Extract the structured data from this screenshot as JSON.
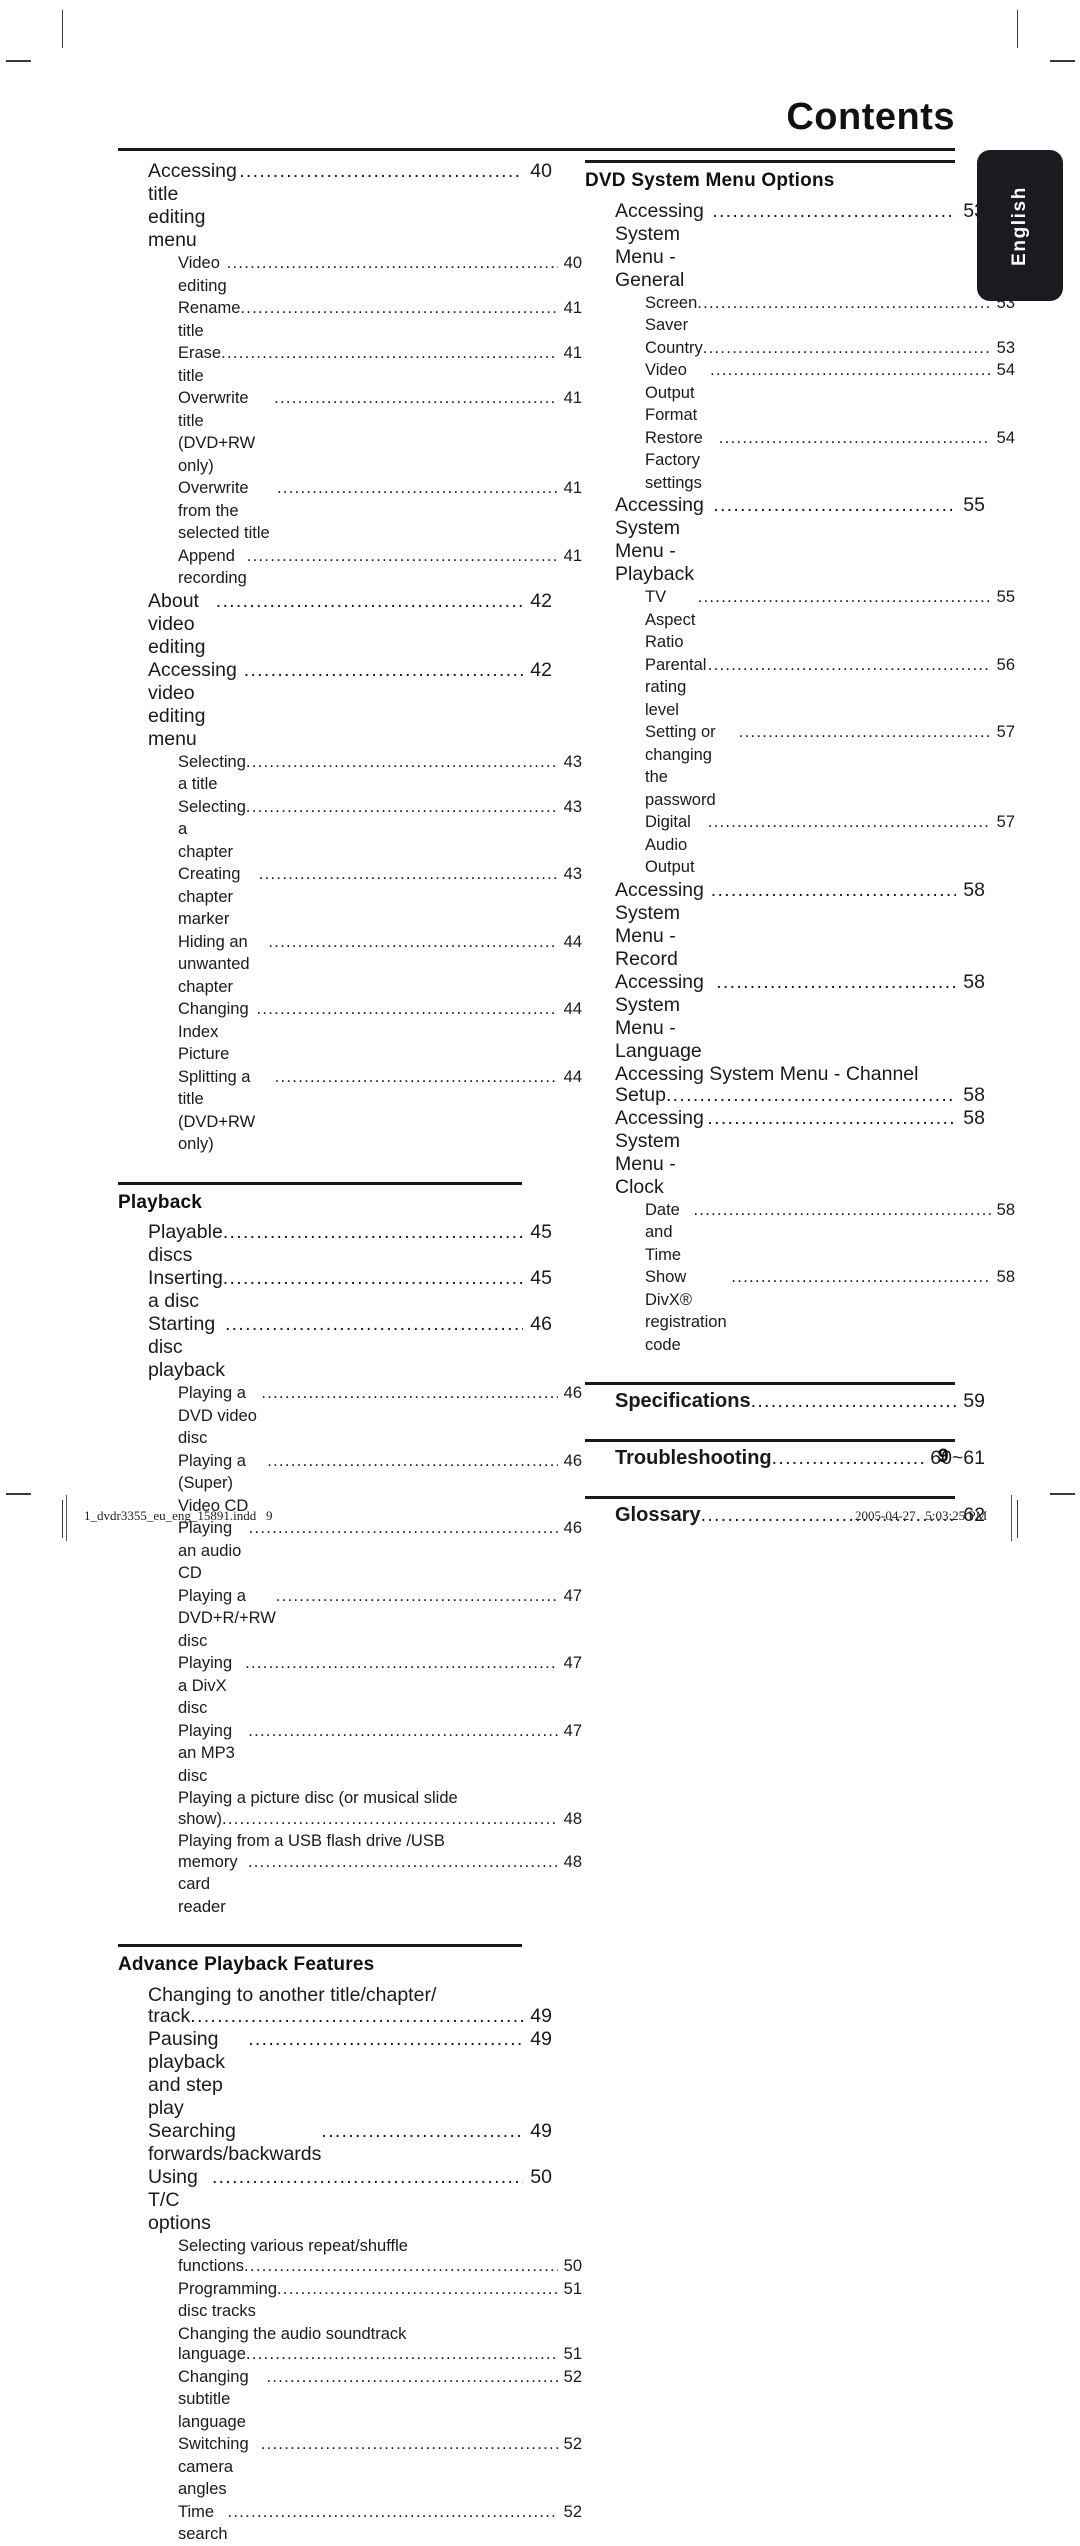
{
  "page": {
    "title": "Contents",
    "folio": "9",
    "language_tab": "English"
  },
  "footer": {
    "file_slug": "1_dvdr3355_eu_eng_15891.indd   9",
    "timestamp": "2005-04-27   5:03:25 PM"
  },
  "leader_dots": "................................................................................................................",
  "left_column": {
    "blocks": [
      {
        "heading": null,
        "rule": false,
        "entries": [
          {
            "level": 1,
            "text": "Accessing title editing menu",
            "page": "40"
          },
          {
            "level": 2,
            "text": "Video editing",
            "page": "40"
          },
          {
            "level": 2,
            "text": "Rename title",
            "page": "41"
          },
          {
            "level": 2,
            "text": "Erase title",
            "page": "41"
          },
          {
            "level": 2,
            "text": "Overwrite title (DVD+RW only)",
            "page": "41"
          },
          {
            "level": 2,
            "text": "Overwrite from the selected title",
            "page": "41"
          },
          {
            "level": 2,
            "text": "Append recording",
            "page": "41"
          },
          {
            "level": 1,
            "text": "About video editing",
            "page": "42"
          },
          {
            "level": 1,
            "text": "Accessing video editing menu",
            "page": "42"
          },
          {
            "level": 2,
            "text": "Selecting a title",
            "page": "43"
          },
          {
            "level": 2,
            "text": "Selecting a chapter",
            "page": "43"
          },
          {
            "level": 2,
            "text": "Creating chapter marker",
            "page": "43"
          },
          {
            "level": 2,
            "text": "Hiding an unwanted chapter",
            "page": "44"
          },
          {
            "level": 2,
            "text": "Changing Index Picture",
            "page": "44"
          },
          {
            "level": 2,
            "text": "Splitting a title (DVD+RW only)",
            "page": "44"
          }
        ]
      },
      {
        "heading": "Playback",
        "rule": true,
        "entries": [
          {
            "level": 1,
            "text": "Playable discs",
            "page": "45"
          },
          {
            "level": 1,
            "text": "Inserting a disc",
            "page": "45"
          },
          {
            "level": 1,
            "text": "Starting disc playback",
            "page": "46"
          },
          {
            "level": 2,
            "text": "Playing a DVD video disc",
            "page": "46"
          },
          {
            "level": 2,
            "text": "Playing a (Super) Video CD",
            "page": "46"
          },
          {
            "level": 2,
            "text": "Playing an audio CD",
            "page": "46"
          },
          {
            "level": 2,
            "text": "Playing a DVD+R/+RW disc",
            "page": "47"
          },
          {
            "level": 2,
            "text": "Playing a DivX disc",
            "page": "47"
          },
          {
            "level": 2,
            "text": "Playing an MP3 disc",
            "page": "47"
          },
          {
            "level": 2,
            "text": "Playing a picture disc (or musical slide",
            "page": "",
            "wrap_start": true
          },
          {
            "level": 2,
            "text": "show)",
            "page": "48",
            "wrap_end": true
          },
          {
            "level": 2,
            "text": "Playing from a USB flash drive /USB",
            "page": "",
            "wrap_start": true
          },
          {
            "level": 2,
            "text": "memory card reader",
            "page": "48",
            "wrap_end": true
          }
        ]
      },
      {
        "heading": "Advance Playback Features",
        "rule": true,
        "entries": [
          {
            "level": 1,
            "text": "Changing to another title/chapter/",
            "page": "",
            "wrap_start": true
          },
          {
            "level": 1,
            "text": "track",
            "page": "49",
            "wrap_end": true
          },
          {
            "level": 1,
            "text": "Pausing playback and step play",
            "page": "49"
          },
          {
            "level": 1,
            "text": "Searching forwards/backwards",
            "page": "49"
          },
          {
            "level": 1,
            "text": "Using T/C options",
            "page": "50"
          },
          {
            "level": 2,
            "text": "Selecting various repeat/shuffle",
            "page": "",
            "wrap_start": true
          },
          {
            "level": 2,
            "text": "functions",
            "page": "50",
            "wrap_end": true
          },
          {
            "level": 2,
            "text": "Programming disc tracks",
            "page": "51"
          },
          {
            "level": 2,
            "text": "Changing the audio soundtrack",
            "page": "",
            "wrap_start": true
          },
          {
            "level": 2,
            "text": "language",
            "page": "51",
            "wrap_end": true
          },
          {
            "level": 2,
            "text": "Changing subtitle language",
            "page": "52"
          },
          {
            "level": 2,
            "text": "Switching camera angles",
            "page": "52"
          },
          {
            "level": 2,
            "text": "Time search",
            "page": "52"
          }
        ]
      }
    ]
  },
  "right_column": {
    "blocks": [
      {
        "heading": "DVD System Menu Options",
        "rule": true,
        "entries": [
          {
            "level": 1,
            "text": "Accessing System Menu - General",
            "page": "53"
          },
          {
            "level": 2,
            "text": "Screen Saver",
            "page": "53"
          },
          {
            "level": 2,
            "text": "Country",
            "page": "53"
          },
          {
            "level": 2,
            "text": "Video Output Format",
            "page": "54"
          },
          {
            "level": 2,
            "text": "Restore Factory settings",
            "page": "54"
          },
          {
            "level": 1,
            "text": "Accessing System Menu -Playback",
            "page": "55"
          },
          {
            "level": 2,
            "text": "TV Aspect Ratio",
            "page": "55"
          },
          {
            "level": 2,
            "text": "Parental rating level",
            "page": "56"
          },
          {
            "level": 2,
            "text": "Setting or changing the password",
            "page": "57"
          },
          {
            "level": 2,
            "text": "Digital Audio Output",
            "page": "57"
          },
          {
            "level": 1,
            "text": "Accessing System Menu - Record",
            "page": "58"
          },
          {
            "level": 1,
            "text": "Accessing System Menu - Language",
            "page": "58"
          },
          {
            "level": 1,
            "text": "Accessing System Menu - Channel",
            "page": "",
            "wrap_start": true
          },
          {
            "level": 1,
            "text": "Setup",
            "page": "58",
            "wrap_end": true
          },
          {
            "level": 1,
            "text": "Accessing System Menu - Clock",
            "page": "58"
          },
          {
            "level": 2,
            "text": "Date and Time",
            "page": "58"
          },
          {
            "level": 2,
            "text": "Show DivX® registration code",
            "page": "58",
            "superscript": "®"
          }
        ]
      },
      {
        "heading": null,
        "rule": true,
        "entries": [
          {
            "level": 1,
            "bold": true,
            "text": "Specifications",
            "page": "59"
          }
        ]
      },
      {
        "heading": null,
        "rule": true,
        "entries": [
          {
            "level": 1,
            "bold": true,
            "text": "Troubleshooting",
            "page": "60~61"
          }
        ]
      },
      {
        "heading": null,
        "rule": true,
        "entries": [
          {
            "level": 1,
            "bold": true,
            "text": "Glossary",
            "page": "62"
          }
        ]
      }
    ]
  }
}
